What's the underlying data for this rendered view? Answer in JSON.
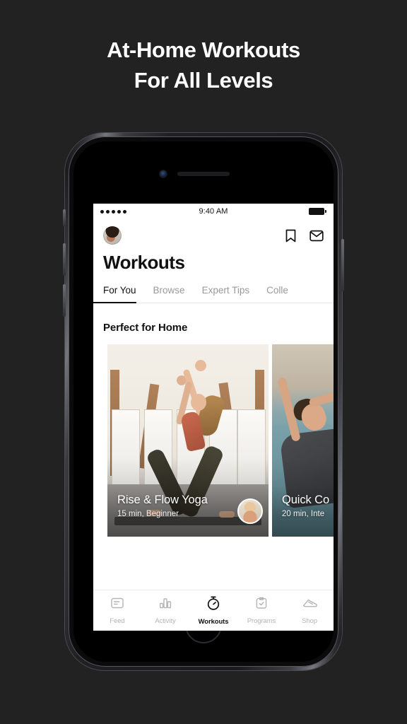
{
  "promo": {
    "line1": "At-Home Workouts",
    "line2": "For All Levels"
  },
  "colors": {
    "background": "#222222",
    "screen": "#ffffff",
    "text_primary": "#111111",
    "text_muted": "#9a9a9a",
    "nav_inactive": "#b4b4b4"
  },
  "status_bar": {
    "signal_dots": 5,
    "time": "9:40 AM",
    "battery_full": true
  },
  "header": {
    "avatar": "user-avatar",
    "actions": [
      {
        "name": "bookmark-icon",
        "label": "Bookmarks"
      },
      {
        "name": "mail-icon",
        "label": "Messages"
      }
    ]
  },
  "page": {
    "title": "Workouts"
  },
  "tabs": [
    {
      "label": "For You",
      "active": true
    },
    {
      "label": "Browse",
      "active": false
    },
    {
      "label": "Expert Tips",
      "active": false
    },
    {
      "label": "Colle",
      "active": false
    }
  ],
  "section": {
    "title": "Perfect for Home"
  },
  "cards": [
    {
      "title": "Rise & Flow Yoga",
      "meta": "15 min, Beginner",
      "instructor_avatar": "instructor-avatar",
      "image": "woman-in-warrior-yoga-pose-in-bright-studio"
    },
    {
      "title": "Quick Co",
      "meta": "20 min, Inte",
      "image": "man-doing-core-exercise-on-blue-mat"
    }
  ],
  "tabbar": [
    {
      "label": "Feed",
      "icon": "feed-icon",
      "active": false
    },
    {
      "label": "Activity",
      "icon": "activity-chart-icon",
      "active": false
    },
    {
      "label": "Workouts",
      "icon": "stopwatch-icon",
      "active": true
    },
    {
      "label": "Programs",
      "icon": "clipboard-check-icon",
      "active": false
    },
    {
      "label": "Shop",
      "icon": "sneaker-icon",
      "active": false
    }
  ]
}
